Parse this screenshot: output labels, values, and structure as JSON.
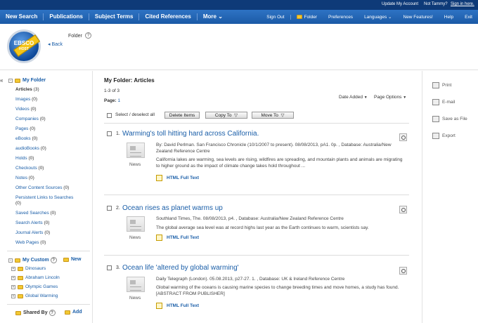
{
  "topbar": {
    "update_account": "Update My Account",
    "not_user": "Not Tammy?",
    "sign_in": "Sign in here."
  },
  "nav": {
    "left": [
      "New Search",
      "Publications",
      "Subject Terms",
      "Cited References",
      "More"
    ],
    "right": {
      "sign_out": "Sign Out",
      "folder": "Folder",
      "preferences": "Preferences",
      "languages": "Languages",
      "new_features": "New Features!",
      "help": "Help",
      "exit": "Exit"
    }
  },
  "header": {
    "folder_label": "Folder",
    "help": "?",
    "back": "Back",
    "logo_text": "EBSCO",
    "logo_sub": "HOST"
  },
  "sidebar": {
    "collapse": "«",
    "my_folder": "My Folder",
    "items": [
      {
        "label": "Articles",
        "count": "(3)"
      },
      {
        "label": "Images",
        "count": "(0)"
      },
      {
        "label": "Videos",
        "count": "(0)"
      },
      {
        "label": "Companies",
        "count": "(0)"
      },
      {
        "label": "Pages",
        "count": "(0)"
      },
      {
        "label": "eBooks",
        "count": "(0)"
      },
      {
        "label": "audioBooks",
        "count": "(0)"
      },
      {
        "label": "Holds",
        "count": "(0)"
      },
      {
        "label": "Checkouts",
        "count": "(0)"
      },
      {
        "label": "Notes",
        "count": "(0)"
      },
      {
        "label": "Other Content Sources",
        "count": "(0)"
      },
      {
        "label": "Persistent Links to Searches",
        "count": "(0)"
      },
      {
        "label": "Saved Searches",
        "count": "(0)"
      },
      {
        "label": "Search Alerts",
        "count": "(0)"
      },
      {
        "label": "Journal Alerts",
        "count": "(0)"
      },
      {
        "label": "Web Pages",
        "count": "(0)"
      }
    ],
    "my_custom": "My Custom",
    "my_custom_help": "?",
    "new": "New",
    "custom_folders": [
      "Dinosaurs",
      "Abraham Lincoln",
      "Olympic Games",
      "Global Warming"
    ],
    "shared_by": "Shared By",
    "shared_help": "?",
    "add": "Add"
  },
  "main": {
    "title": "My Folder: Articles",
    "range": "1-3 of 3",
    "page_label": "Page:",
    "page_num": "1",
    "date_added": "Date Added",
    "page_options": "Page Options",
    "select_all": "Select / deselect all",
    "delete": "Delete Items",
    "copy": "Copy To",
    "move": "Move To"
  },
  "results": [
    {
      "num": "1.",
      "title": "Warming's toll hitting hard across California.",
      "lines": [
        "By: David Perlman. San Francisco Chronicle (10/1/2007 to present). 08/08/2013, pA1. 0p. , Database: Australia/New Zealand Reference Centre",
        "California lakes are warming, sea levels are rising, wildfires are spreading, and mountain plants and animals are migrating to higher ground as the impact of climate change takes hold throughout ..."
      ],
      "type": "News",
      "link": "HTML Full Text"
    },
    {
      "num": "2.",
      "title": "Ocean rises as planet warms up",
      "lines": [
        "Southland Times, The. 08/08/2013, p4. , Database: Australia/New Zealand Reference Centre",
        "The global average sea level was at record highs last year as the Earth continues to warm, scientists say."
      ],
      "type": "News",
      "link": "HTML Full Text"
    },
    {
      "num": "3.",
      "title": "Ocean life 'altered by global warming'",
      "lines": [
        "Daily Telegraph (London). 05.08.2013, p27-27. 1. , Database: UK & Ireland Reference Centre",
        "Global warming of the oceans is causing marine species to change breeding times and move homes, a study has found. [ABSTRACT FROM PUBLISHER]"
      ],
      "type": "News",
      "link": "HTML Full Text"
    }
  ],
  "tools": [
    "Print",
    "E-mail",
    "Save as File",
    "Export"
  ],
  "colors": {
    "topbar": "#0e3a78",
    "nav": "#1f5fab",
    "link": "#1a5ea8",
    "folder": "#f2c832"
  }
}
